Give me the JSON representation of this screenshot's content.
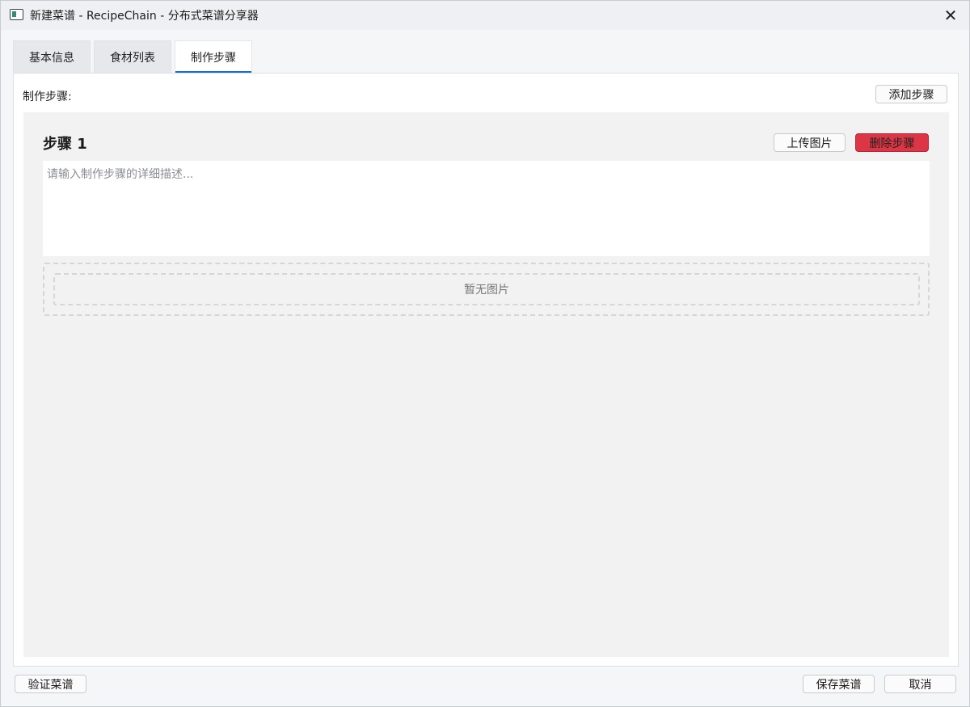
{
  "window": {
    "title": "新建菜谱 - RecipeChain - 分布式菜谱分享器",
    "close_glyph": "✕",
    "icon": "app-window-icon"
  },
  "tabs": [
    {
      "label": "基本信息",
      "active": false
    },
    {
      "label": "食材列表",
      "active": false
    },
    {
      "label": "制作步骤",
      "active": true
    }
  ],
  "steps_panel": {
    "label": "制作步骤:",
    "add_step_label": "添加步骤",
    "steps": [
      {
        "title": "步骤 1",
        "upload_label": "上传图片",
        "delete_label": "删除步骤",
        "description_value": "",
        "description_placeholder": "请输入制作步骤的详细描述...",
        "image_placeholder": "暂无图片"
      }
    ]
  },
  "footer": {
    "verify_label": "验证菜谱",
    "save_label": "保存菜谱",
    "cancel_label": "取消"
  },
  "colors": {
    "accent": "#1b6ec2",
    "danger": "#dc3545"
  }
}
